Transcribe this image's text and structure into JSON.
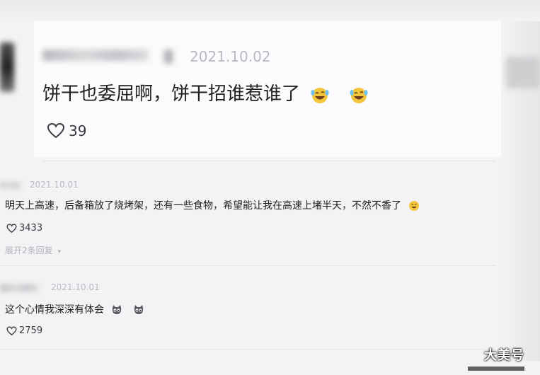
{
  "comments": [
    {
      "date": "2021.10.02",
      "text": "饼干也委屈啊，饼干招谁惹谁了",
      "emojis": [
        "laugh-cry-icon",
        "laugh-cry-icon"
      ],
      "likes": "39"
    },
    {
      "date": "2021.10.01",
      "text": "明天上高速，后备箱放了烧烤架，还有一些食物，希望能让我在高速上堵半天，不然不香了",
      "emojis": [
        "grin-icon"
      ],
      "likes": "3433",
      "expand": "展开2条回复"
    },
    {
      "date": "2021.10.01",
      "text": "这个心情我深深有体会",
      "emojis": [
        "cat-face-icon",
        "cat-face-icon"
      ],
      "likes": "2759"
    }
  ],
  "watermark": "大美号",
  "colors": {
    "background": "#f3f2f4",
    "card": "#fbfafc",
    "date": "#b9b9bf",
    "text": "#1f1f22",
    "emoji": "#f2c53d"
  }
}
